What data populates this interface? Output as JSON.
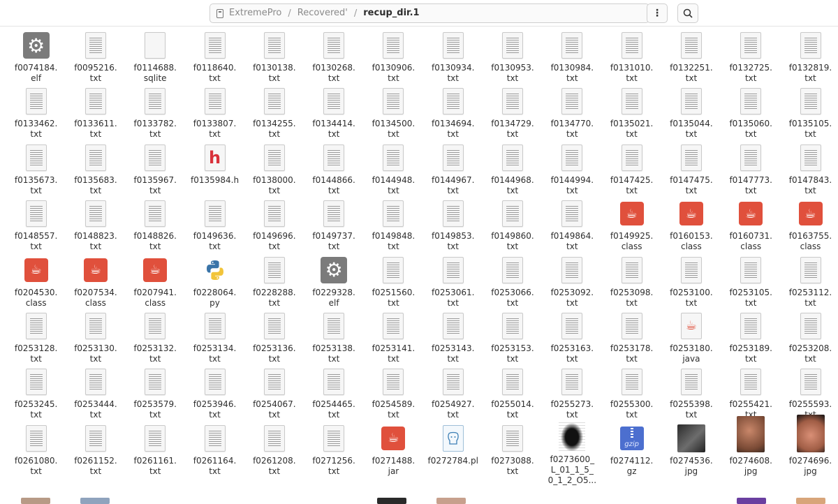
{
  "path": {
    "crumbs": [
      "ExtremePro",
      "Recovered'",
      "recup_dir.1"
    ],
    "separator": "/"
  },
  "toolbar": {
    "menu_label": "⋮"
  },
  "files": [
    {
      "name": "f0074184.\nelf",
      "icon": "gear-icon"
    },
    {
      "name": "f0095216.\ntxt",
      "icon": "text-file-icon"
    },
    {
      "name": "f0114688.\nsqlite",
      "icon": "blank-file-icon"
    },
    {
      "name": "f0118640.\ntxt",
      "icon": "text-file-icon"
    },
    {
      "name": "f0130138.\ntxt",
      "icon": "text-file-icon"
    },
    {
      "name": "f0130268.\ntxt",
      "icon": "text-file-icon"
    },
    {
      "name": "f0130906.\ntxt",
      "icon": "text-file-icon"
    },
    {
      "name": "f0130934.\ntxt",
      "icon": "text-file-icon"
    },
    {
      "name": "f0130953.\ntxt",
      "icon": "text-file-icon"
    },
    {
      "name": "f0130984.\ntxt",
      "icon": "text-file-icon"
    },
    {
      "name": "f0131010.\ntxt",
      "icon": "text-file-icon"
    },
    {
      "name": "f0132251.\ntxt",
      "icon": "text-file-icon"
    },
    {
      "name": "f0132725.\ntxt",
      "icon": "text-file-icon"
    },
    {
      "name": "f0132819.\ntxt",
      "icon": "text-file-icon"
    },
    {
      "name": "f0133462.\ntxt",
      "icon": "text-file-icon"
    },
    {
      "name": "f0133611.\ntxt",
      "icon": "text-file-icon"
    },
    {
      "name": "f0133782.\ntxt",
      "icon": "text-file-icon"
    },
    {
      "name": "f0133807.\ntxt",
      "icon": "text-file-icon"
    },
    {
      "name": "f0134255.\ntxt",
      "icon": "text-file-icon"
    },
    {
      "name": "f0134414.\ntxt",
      "icon": "text-file-icon"
    },
    {
      "name": "f0134500.\ntxt",
      "icon": "text-file-icon"
    },
    {
      "name": "f0134694.\ntxt",
      "icon": "text-file-icon"
    },
    {
      "name": "f0134729.\ntxt",
      "icon": "text-file-icon"
    },
    {
      "name": "f0134770.\ntxt",
      "icon": "text-file-icon"
    },
    {
      "name": "f0135021.\ntxt",
      "icon": "text-file-icon"
    },
    {
      "name": "f0135044.\ntxt",
      "icon": "text-file-icon"
    },
    {
      "name": "f0135060.\ntxt",
      "icon": "text-file-icon"
    },
    {
      "name": "f0135105.\ntxt",
      "icon": "text-file-icon"
    },
    {
      "name": "f0135673.\ntxt",
      "icon": "text-file-icon"
    },
    {
      "name": "f0135683.\ntxt",
      "icon": "text-file-icon"
    },
    {
      "name": "f0135967.\ntxt",
      "icon": "text-file-icon"
    },
    {
      "name": "f0135984.h",
      "icon": "h-file-icon"
    },
    {
      "name": "f0138000.\ntxt",
      "icon": "text-file-icon"
    },
    {
      "name": "f0144866.\ntxt",
      "icon": "text-file-icon"
    },
    {
      "name": "f0144948.\ntxt",
      "icon": "text-file-icon"
    },
    {
      "name": "f0144967.\ntxt",
      "icon": "text-file-icon"
    },
    {
      "name": "f0144968.\ntxt",
      "icon": "text-file-icon"
    },
    {
      "name": "f0144994.\ntxt",
      "icon": "text-file-icon"
    },
    {
      "name": "f0147425.\ntxt",
      "icon": "text-file-icon"
    },
    {
      "name": "f0147475.\ntxt",
      "icon": "text-file-icon"
    },
    {
      "name": "f0147773.\ntxt",
      "icon": "text-file-icon"
    },
    {
      "name": "f0147843.\ntxt",
      "icon": "text-file-icon"
    },
    {
      "name": "f0148557.\ntxt",
      "icon": "text-file-icon"
    },
    {
      "name": "f0148823.\ntxt",
      "icon": "text-file-icon"
    },
    {
      "name": "f0148826.\ntxt",
      "icon": "text-file-icon"
    },
    {
      "name": "f0149636.\ntxt",
      "icon": "text-file-icon"
    },
    {
      "name": "f0149696.\ntxt",
      "icon": "text-file-icon"
    },
    {
      "name": "f0149737.\ntxt",
      "icon": "text-file-icon"
    },
    {
      "name": "f0149848.\ntxt",
      "icon": "text-file-icon"
    },
    {
      "name": "f0149853.\ntxt",
      "icon": "text-file-icon"
    },
    {
      "name": "f0149860.\ntxt",
      "icon": "text-file-icon"
    },
    {
      "name": "f0149864.\ntxt",
      "icon": "text-file-icon"
    },
    {
      "name": "f0149925.\nclass",
      "icon": "java-class-icon"
    },
    {
      "name": "f0160153.\nclass",
      "icon": "java-class-icon"
    },
    {
      "name": "f0160731.\nclass",
      "icon": "java-class-icon"
    },
    {
      "name": "f0163755.\nclass",
      "icon": "java-class-icon"
    },
    {
      "name": "f0204530.\nclass",
      "icon": "java-class-icon"
    },
    {
      "name": "f0207534.\nclass",
      "icon": "java-class-icon"
    },
    {
      "name": "f0207941.\nclass",
      "icon": "java-class-icon"
    },
    {
      "name": "f0228064.\npy",
      "icon": "python-icon"
    },
    {
      "name": "f0228288.\ntxt",
      "icon": "text-file-icon"
    },
    {
      "name": "f0229328.\nelf",
      "icon": "gear-icon"
    },
    {
      "name": "f0251560.\ntxt",
      "icon": "text-file-icon"
    },
    {
      "name": "f0253061.\ntxt",
      "icon": "text-file-icon"
    },
    {
      "name": "f0253066.\ntxt",
      "icon": "text-file-icon"
    },
    {
      "name": "f0253092.\ntxt",
      "icon": "text-file-icon"
    },
    {
      "name": "f0253098.\ntxt",
      "icon": "text-file-icon"
    },
    {
      "name": "f0253100.\ntxt",
      "icon": "text-file-icon"
    },
    {
      "name": "f0253105.\ntxt",
      "icon": "text-file-icon"
    },
    {
      "name": "f0253112.\ntxt",
      "icon": "text-file-icon"
    },
    {
      "name": "f0253128.\ntxt",
      "icon": "text-file-icon"
    },
    {
      "name": "f0253130.\ntxt",
      "icon": "text-file-icon"
    },
    {
      "name": "f0253132.\ntxt",
      "icon": "text-file-icon"
    },
    {
      "name": "f0253134.\ntxt",
      "icon": "text-file-icon"
    },
    {
      "name": "f0253136.\ntxt",
      "icon": "text-file-icon"
    },
    {
      "name": "f0253138.\ntxt",
      "icon": "text-file-icon"
    },
    {
      "name": "f0253141.\ntxt",
      "icon": "text-file-icon"
    },
    {
      "name": "f0253143.\ntxt",
      "icon": "text-file-icon"
    },
    {
      "name": "f0253153.\ntxt",
      "icon": "text-file-icon"
    },
    {
      "name": "f0253163.\ntxt",
      "icon": "text-file-icon"
    },
    {
      "name": "f0253178.\ntxt",
      "icon": "text-file-icon"
    },
    {
      "name": "f0253180.\njava",
      "icon": "java-source-icon"
    },
    {
      "name": "f0253189.\ntxt",
      "icon": "text-file-icon"
    },
    {
      "name": "f0253208.\ntxt",
      "icon": "text-file-icon"
    },
    {
      "name": "f0253245.\ntxt",
      "icon": "text-file-icon"
    },
    {
      "name": "f0253444.\ntxt",
      "icon": "text-file-icon"
    },
    {
      "name": "f0253579.\ntxt",
      "icon": "text-file-icon"
    },
    {
      "name": "f0253946.\ntxt",
      "icon": "text-file-icon"
    },
    {
      "name": "f0254067.\ntxt",
      "icon": "text-file-icon"
    },
    {
      "name": "f0254465.\ntxt",
      "icon": "text-file-icon"
    },
    {
      "name": "f0254589.\ntxt",
      "icon": "text-file-icon"
    },
    {
      "name": "f0254927.\ntxt",
      "icon": "text-file-icon"
    },
    {
      "name": "f0255014.\ntxt",
      "icon": "text-file-icon"
    },
    {
      "name": "f0255273.\ntxt",
      "icon": "text-file-icon"
    },
    {
      "name": "f0255300.\ntxt",
      "icon": "text-file-icon"
    },
    {
      "name": "f0255398.\ntxt",
      "icon": "text-file-icon"
    },
    {
      "name": "f0255421.\ntxt",
      "icon": "text-file-icon"
    },
    {
      "name": "f0255593.\ntxt",
      "icon": "text-file-icon"
    },
    {
      "name": "f0261080.\ntxt",
      "icon": "text-file-icon"
    },
    {
      "name": "f0261152.\ntxt",
      "icon": "text-file-icon"
    },
    {
      "name": "f0261161.\ntxt",
      "icon": "text-file-icon"
    },
    {
      "name": "f0261164.\ntxt",
      "icon": "text-file-icon"
    },
    {
      "name": "f0261208.\ntxt",
      "icon": "text-file-icon"
    },
    {
      "name": "f0271256.\ntxt",
      "icon": "text-file-icon"
    },
    {
      "name": "f0271488.\njar",
      "icon": "java-class-icon"
    },
    {
      "name": "f0272784.pl",
      "icon": "perl-icon"
    },
    {
      "name": "f0273088.\ntxt",
      "icon": "text-file-icon"
    },
    {
      "name": "f0273600_\nL_01_1_5_\n0_1_2_O5...",
      "icon": "image-thumbnail-scan"
    },
    {
      "name": "f0274112.\ngz",
      "icon": "gzip-icon"
    },
    {
      "name": "f0274536.\njpg",
      "icon": "image-thumbnail-dark"
    },
    {
      "name": "f0274608.\njpg",
      "icon": "image-thumbnail-portrait"
    },
    {
      "name": "f0274696.\njpg",
      "icon": "image-thumbnail-wide"
    }
  ]
}
